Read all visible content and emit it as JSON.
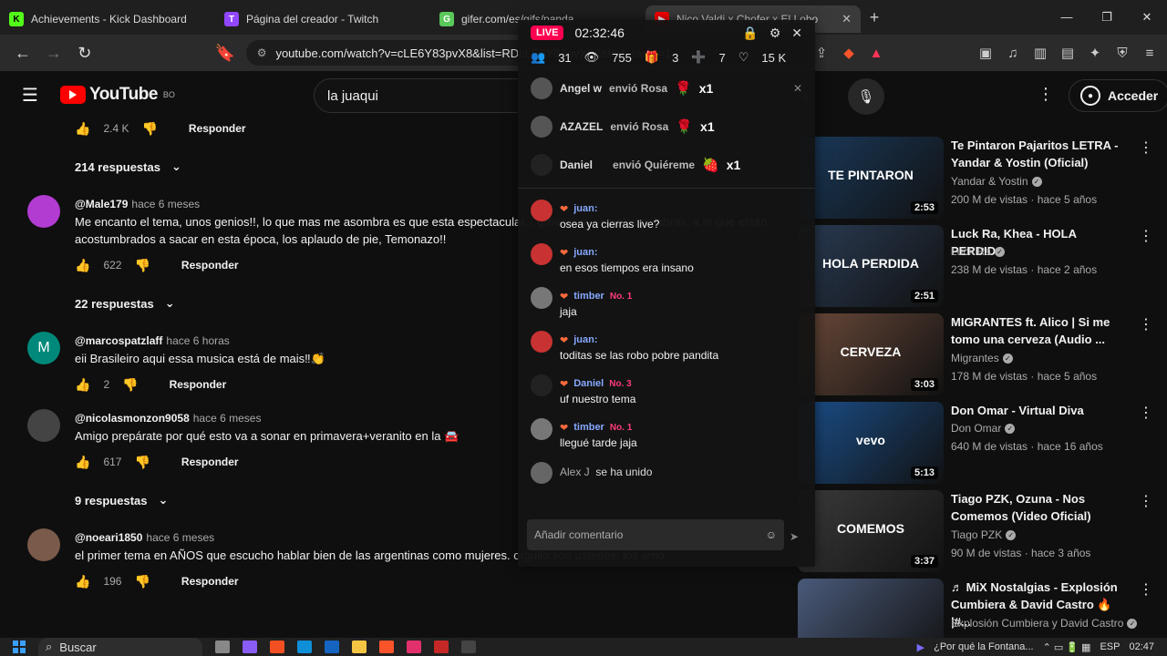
{
  "tabs": [
    {
      "title": "Achievements - Kick Dashboard",
      "icon": "K",
      "color": "#53fc18"
    },
    {
      "title": "Página del creador - Twitch",
      "icon": "T",
      "color": "#9146ff"
    },
    {
      "title": "gifer.com/es/gifs/panda",
      "icon": "G",
      "color": "#5ac85a"
    },
    {
      "title": "Nico Valdi x Chofer x El Lobo",
      "icon": "▶",
      "color": "#ff0000"
    }
  ],
  "url": "youtube.com/watch?v=cLE6Y83pvX8&list=RDcLE6Y83pvX8&start_radio=1",
  "header": {
    "logo_text": "YouTube",
    "region": "BO",
    "search_value": "la juaqui",
    "signin_label": "Acceder"
  },
  "comments": {
    "top_likes": "2.4 K",
    "top_reply": "Responder",
    "top_replies_toggle": "214 respuestas",
    "items": [
      {
        "author": "@Male179",
        "time": "hace 6 meses",
        "text": "Me encanto el tema, unos genios!!, lo que mas me asombra es que esta espectacular... groserías, ni malas palabras, a lo que están acostumbrados a sacar en esta época, los aplaudo de pie, Temonazo!!",
        "likes": "622",
        "reply": "Responder",
        "replies": "22 respuestas",
        "avatar_color": "#b23bd1",
        "avatar_letter": ""
      },
      {
        "author": "@marcospatzlaff",
        "time": "hace 6 horas",
        "text": "eii Brasileiro aqui essa musica está de mais‼👏",
        "likes": "2",
        "reply": "Responder",
        "replies": "",
        "avatar_color": "#00897b",
        "avatar_letter": "M"
      },
      {
        "author": "@nicolasmonzon9058",
        "time": "hace 6 meses",
        "text": "Amigo prepárate por qué esto va a sonar en primavera+veranito en la 🚘",
        "likes": "617",
        "reply": "Responder",
        "replies": "9 respuestas",
        "avatar_color": "#444444",
        "avatar_letter": ""
      },
      {
        "author": "@noeari1850",
        "time": "hace 6 meses",
        "text": "el primer tema en AÑOS que escucho hablar bien de las argentinas como mujeres. orgullo son ustedes. los amo.",
        "likes": "196",
        "reply": "Responder",
        "replies": "",
        "avatar_color": "#7a5a4a",
        "avatar_letter": ""
      }
    ]
  },
  "recommendations": [
    {
      "title": "Te Pintaron Pajaritos LETRA - Yandar & Yostin (Oficial)",
      "channel": "Yandar & Yostin",
      "meta": "200 M de vistas · hace 5 años",
      "duration": "2:53",
      "thumb_color": "#1a3a5c",
      "thumb_text": "TE PINTARON"
    },
    {
      "title": "Luck Ra, Khea - HOLA PERDIDA",
      "channel": "Luck Ra",
      "meta": "238 M de vistas · hace 2 años",
      "duration": "2:51",
      "thumb_color": "#2a3c55",
      "thumb_text": "HOLA PERDIDA"
    },
    {
      "title": "MIGRANTES ft. Alico | Si me tomo una cerveza (Audio ...",
      "channel": "Migrantes",
      "meta": "178 M de vistas · hace 5 años",
      "duration": "3:03",
      "thumb_color": "#6b4a3a",
      "thumb_text": "CERVEZA"
    },
    {
      "title": "Don Omar - Virtual Diva",
      "channel": "Don Omar",
      "meta": "640 M de vistas · hace 16 años",
      "duration": "5:13",
      "thumb_color": "#1b4f8a",
      "thumb_text": "vevo"
    },
    {
      "title": "Tiago PZK, Ozuna - Nos Comemos (Video Oficial)",
      "channel": "Tiago PZK",
      "meta": "90 M de vistas · hace 3 años",
      "duration": "3:37",
      "thumb_color": "#3b3b3b",
      "thumb_text": "COMEMOS"
    },
    {
      "title": "♬ MiX Nostalgias - Explosión Cumbiera & David Castro 🔥 |#...",
      "channel": "Explosión Cumbiera y David Castro",
      "meta": "",
      "duration": "",
      "thumb_color": "#4a5a7a",
      "thumb_text": ""
    }
  ],
  "live": {
    "badge": "LIVE",
    "time": "02:32:46",
    "stats": {
      "members": "31",
      "views": "755",
      "gifts": "3",
      "follows": "7",
      "likes": "15 K"
    },
    "gifts": [
      {
        "user": "Angel w",
        "text": "envió Rosa",
        "count": "x1"
      },
      {
        "user": "AZAZEL",
        "text": "envió Rosa",
        "count": "x1"
      },
      {
        "user": "Daniel",
        "text": "envió Quiéreme",
        "count": "x1"
      }
    ],
    "messages": [
      {
        "user": "juan:",
        "rank": "",
        "text": "osea ya cierras live?",
        "avatar_color": "#c83232"
      },
      {
        "user": "juan:",
        "rank": "",
        "text": "en esos tiempos era insano",
        "avatar_color": "#c83232"
      },
      {
        "user": "timber",
        "rank": "No. 1",
        "text": "jaja",
        "avatar_color": "#777777"
      },
      {
        "user": "juan:",
        "rank": "",
        "text": "toditas se las robo pobre pandita",
        "avatar_color": "#c83232"
      },
      {
        "user": "Daniel",
        "rank": "No. 3",
        "text": "uf nuestro tema",
        "avatar_color": "#222222"
      },
      {
        "user": "timber",
        "rank": "No. 1",
        "text": "llegué tarde jaja",
        "avatar_color": "#777777"
      }
    ],
    "joined_user": "Alex J",
    "joined_text": "se ha unido",
    "comment_placeholder": "Añadir comentario"
  },
  "taskbar": {
    "search_label": "Buscar",
    "now_playing": "¿Por qué la Fontana...",
    "lang": "ESP",
    "clock": "02:47"
  }
}
